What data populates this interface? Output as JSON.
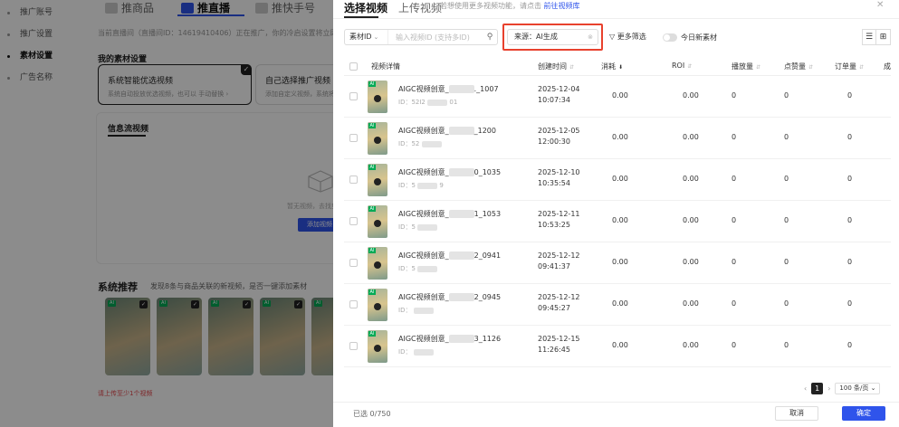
{
  "background": {
    "nav": [
      {
        "label": "推广账号",
        "active": false
      },
      {
        "label": "推广设置",
        "active": false
      },
      {
        "label": "素材设置",
        "active": true
      },
      {
        "label": "广告名称",
        "active": false
      }
    ],
    "tabs": [
      {
        "label": "推商品",
        "active": false
      },
      {
        "label": "推直播",
        "active": true
      },
      {
        "label": "推快手号",
        "active": false
      }
    ],
    "hint": "当前直播间（直播间ID：1461941040​6）正在推广，你的冷启设置将立即生效",
    "my_material_title": "我的素材设置",
    "option_cards": [
      {
        "title": "系统智能优选视频",
        "desc": "系统自动投放优选视频，也可以 手动替换 ›",
        "selected": true
      },
      {
        "title": "自己选择推广视频",
        "desc": "添加自定义视频，系统将投放",
        "selected": false
      }
    ],
    "feed_video_tab": "信息流视频",
    "empty_text": "暂无视频，去找剪映...",
    "add_video_label": "添加视频",
    "rec_title": "系统推荐",
    "rec_desc": "发现8条与商品关联的新视频，是否一键添加素材",
    "rec_badge": "AI",
    "rec_count": 5,
    "warn_text": "请上传至少1个视频"
  },
  "drawer": {
    "tabs": [
      {
        "label": "选择视频",
        "active": true
      },
      {
        "label": "上传视频",
        "active": false
      }
    ],
    "note": "若想使用更多视频功能，请点击",
    "note_link": "前往视频库",
    "close_icon": "close-icon",
    "filter": {
      "type_label": "素材ID",
      "input_placeholder": "输入视频ID (支持多ID)",
      "source_tag": "来源：AI生成",
      "more_filter_label": "更多筛选",
      "today_new_label": "今日新素材",
      "today_new_on": false
    },
    "columns": [
      "视频详情",
      "创建时间",
      "消耗",
      "ROI",
      "播放量",
      "点赞量",
      "订单量",
      "成"
    ],
    "rows": [
      {
        "name_prefix": "AIGC视频创意_",
        "name_suffix": "._1007",
        "id": "ID：52I2",
        "id_tail": "01",
        "date": "2025-12-04",
        "time": "10:07:34",
        "cost": "0.00",
        "roi": "0.00",
        "plays": "0",
        "likes": "0",
        "orders": "0"
      },
      {
        "name_prefix": "AIGC视频创意_",
        "name_suffix": "_1200",
        "id": "ID：52",
        "id_tail": "",
        "date": "2025-12-05",
        "time": "12:00:30",
        "cost": "0.00",
        "roi": "0.00",
        "plays": "0",
        "likes": "0",
        "orders": "0"
      },
      {
        "name_prefix": "AIGC视频创意_",
        "name_suffix": "0_1035",
        "id": "ID：5",
        "id_tail": "9",
        "date": "2025-12-10",
        "time": "10:35:54",
        "cost": "0.00",
        "roi": "0.00",
        "plays": "0",
        "likes": "0",
        "orders": "0"
      },
      {
        "name_prefix": "AIGC视频创意_",
        "name_suffix": "1_1053",
        "id": "ID：5",
        "id_tail": "",
        "date": "2025-12-11",
        "time": "10:53:25",
        "cost": "0.00",
        "roi": "0.00",
        "plays": "0",
        "likes": "0",
        "orders": "0"
      },
      {
        "name_prefix": "AIGC视频创意_",
        "name_suffix": "2_0941",
        "id": "ID：5",
        "id_tail": "",
        "date": "2025-12-12",
        "time": "09:41:37",
        "cost": "0.00",
        "roi": "0.00",
        "plays": "0",
        "likes": "0",
        "orders": "0"
      },
      {
        "name_prefix": "AIGC视频创意_",
        "name_suffix": "2_0945",
        "id": "ID：",
        "id_tail": "",
        "date": "2025-12-12",
        "time": "09:45:27",
        "cost": "0.00",
        "roi": "0.00",
        "plays": "0",
        "likes": "0",
        "orders": "0"
      },
      {
        "name_prefix": "AIGC视频创意_",
        "name_suffix": "3_1126",
        "id": "ID：",
        "id_tail": "",
        "date": "2025-12-15",
        "time": "11:26:45",
        "cost": "0.00",
        "roi": "0.00",
        "plays": "0",
        "likes": "0",
        "orders": "0"
      }
    ],
    "thumb_badge": "AI",
    "pagination": {
      "current": "1",
      "page_size": "100 条/页"
    },
    "selected_count": "已选 0/750",
    "cancel_label": "取消",
    "confirm_label": "确定",
    "colors": {
      "primary": "#2f54eb",
      "highlight_box": "#e8412d"
    }
  }
}
